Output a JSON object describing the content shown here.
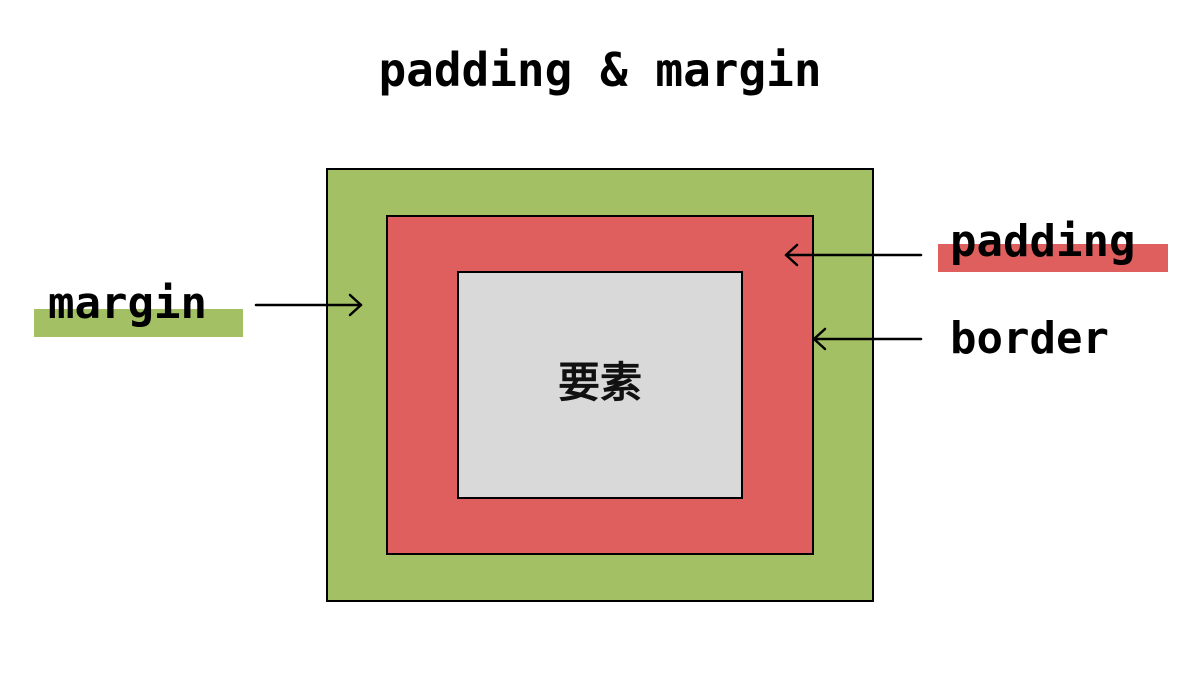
{
  "title": "padding & margin",
  "element_label": "要素",
  "labels": {
    "margin": "margin",
    "padding": "padding",
    "border": "border"
  },
  "colors": {
    "margin": "#a3c164",
    "padding": "#df5e5e",
    "element": "#d9d9d9",
    "border": "#000000",
    "background": "#ffffff"
  }
}
